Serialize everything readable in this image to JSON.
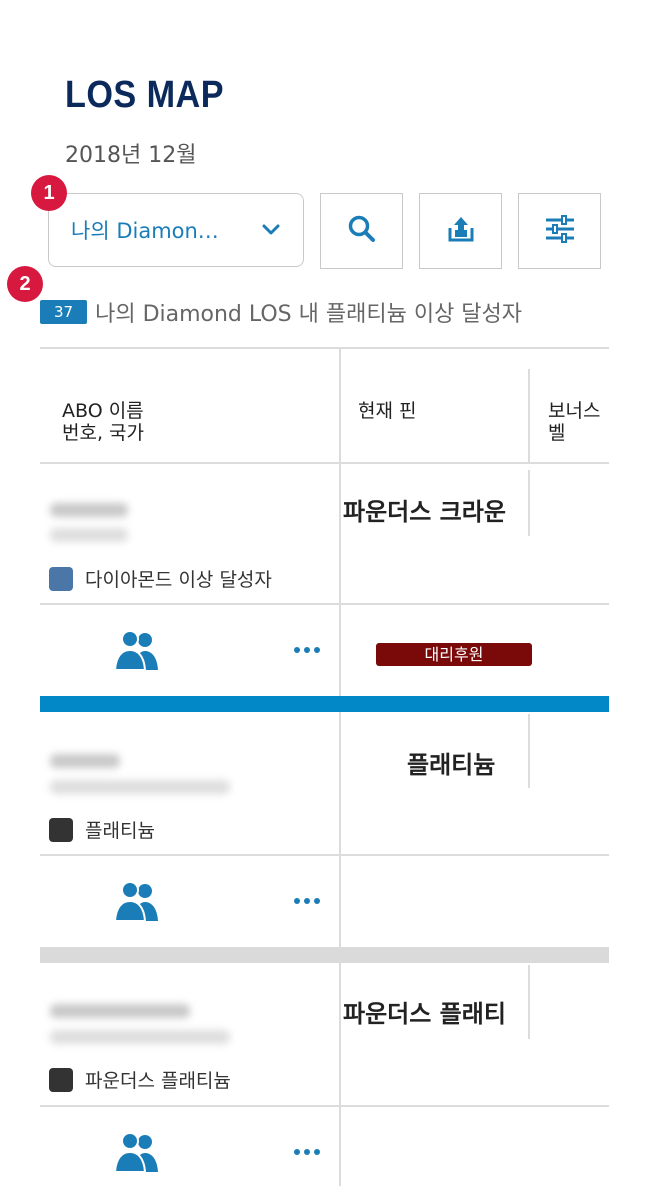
{
  "header": {
    "title": "LOS MAP",
    "date": "2018년 12월"
  },
  "markers": [
    "1",
    "2"
  ],
  "toolbar": {
    "dropdown_label": "나의 Diamon…",
    "search_icon": "search-icon",
    "export_icon": "share-upload-icon",
    "filter_icon": "sliders-icon"
  },
  "summary": {
    "count": "37",
    "text": "나의 Diamond LOS 내 플래티늄 이상 달성자"
  },
  "table": {
    "headers": {
      "col1_line1": "ABO 이름",
      "col1_line2": "번호, 국가",
      "col2": "현재 핀",
      "col3_line1": "보너스",
      "col3_line2": "벨"
    },
    "rows": [
      {
        "pin": "파운더스 크라운",
        "legend": "다이아몬드 이상 달성자",
        "legend_color": "#4a76a8",
        "badge": "대리후원"
      },
      {
        "pin": "플래티늄",
        "legend": "플래티늄",
        "legend_color": "#333333"
      },
      {
        "pin": "파운더스 플래티",
        "legend": "파운더스 플래티늄",
        "legend_color": "#333333"
      }
    ]
  },
  "colors": {
    "title": "#0b2a5b",
    "accent": "#1b7db8",
    "marker": "#d7193f",
    "blue_band": "#0288c7",
    "gray_band": "#dadada",
    "proxy_badge": "#7a0a0a"
  }
}
